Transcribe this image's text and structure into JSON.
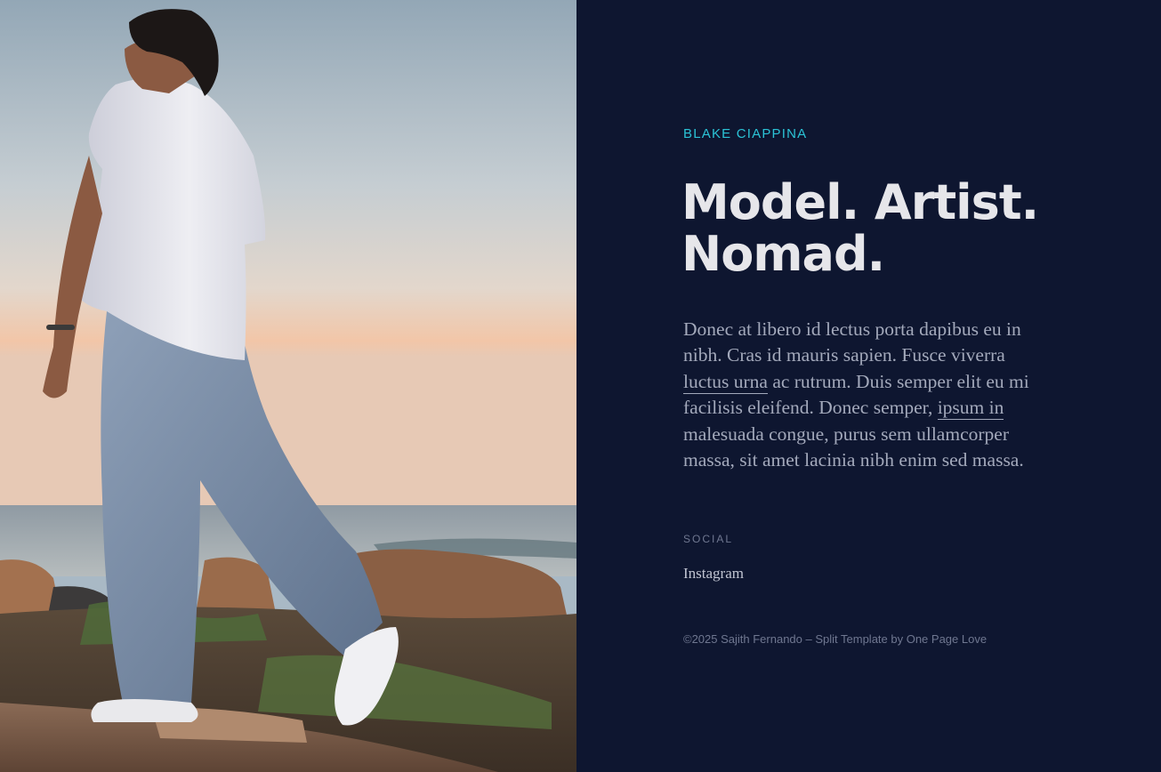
{
  "hero": {
    "image_alt": "Person in white shirt and jeans stepping across rocks by the sea at sunset"
  },
  "profile": {
    "name": "BLAKE CIAPPINA",
    "headline_line1": "Model. Artist.",
    "headline_line2": "Nomad."
  },
  "intro": {
    "text_1": "Donec at libero id lectus porta dapibus eu in nibh. Cras id mauris sapien. Fusce viverra ",
    "link_1": "luctus urna",
    "text_2": " ac rutrum. Duis semper elit eu mi facilisis eleifend. Donec semper, ",
    "link_2": "ipsum in",
    "text_3": " malesuada congue, purus sem ullamcorper massa, sit amet lacinia nibh enim sed massa."
  },
  "social": {
    "label": "SOCIAL",
    "links": [
      {
        "label": "Instagram"
      }
    ]
  },
  "footer": {
    "copyright": "©2025 Sajith Fernando – Split Template by ",
    "credit_link": "One Page Love"
  },
  "colors": {
    "background": "#0e1630",
    "accent": "#2bc3d6",
    "heading": "#e6e6ea",
    "body_text": "#a3a9bb",
    "muted": "#6f7790"
  }
}
